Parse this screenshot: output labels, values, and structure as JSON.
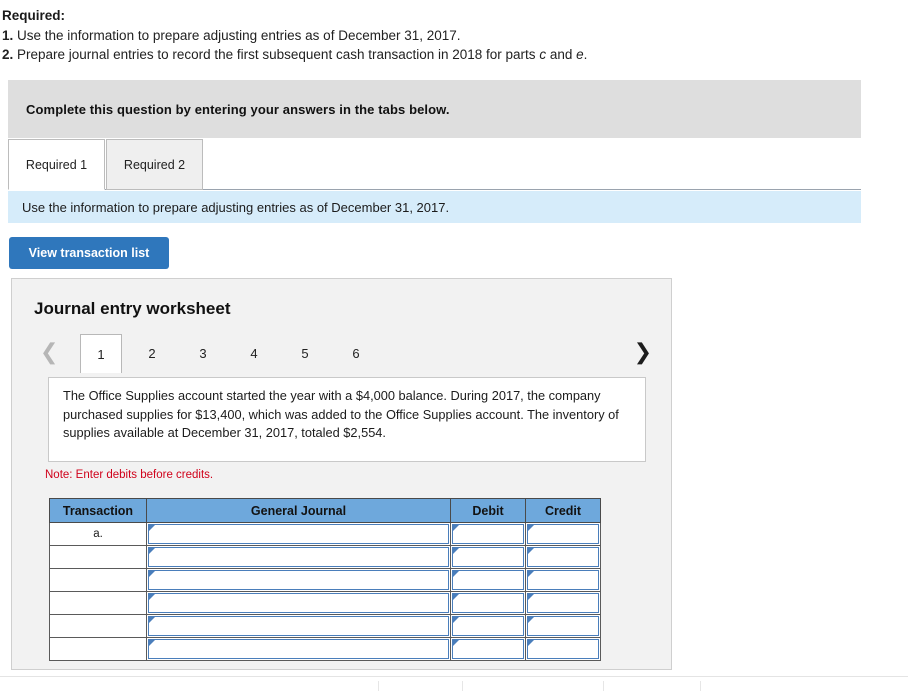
{
  "required": {
    "heading": "Required:",
    "items": [
      {
        "num": "1.",
        "text_before": " Use the information to prepare adjusting entries as of December 31, 2017.",
        "italic_a": "",
        "text_mid": "",
        "italic_b": "",
        "text_after": ""
      },
      {
        "num": "2.",
        "text_before": " Prepare journal entries to record the first subsequent cash transaction in 2018 for parts ",
        "italic_a": "c",
        "text_mid": " and ",
        "italic_b": "e",
        "text_after": "."
      }
    ]
  },
  "instruction_banner": {
    "text": "Complete this question by entering your answers in the tabs below.",
    "background": "#dedede"
  },
  "tabs": [
    {
      "label": "Required 1",
      "active": true
    },
    {
      "label": "Required 2",
      "active": false
    }
  ],
  "info_banner": {
    "text": "Use the information to prepare adjusting entries as of December 31, 2017.",
    "background": "#d6ecfa"
  },
  "toolbar": {
    "view_transaction_label": "View transaction list",
    "button_color": "#2f77bc"
  },
  "worksheet": {
    "title": "Journal entry worksheet",
    "prev_icon": "chevron-left-icon",
    "next_icon": "chevron-right-icon",
    "prev_enabled": false,
    "next_enabled": true,
    "pages": [
      {
        "label": "1",
        "active": true
      },
      {
        "label": "2",
        "active": false
      },
      {
        "label": "3",
        "active": false
      },
      {
        "label": "4",
        "active": false
      },
      {
        "label": "5",
        "active": false
      },
      {
        "label": "6",
        "active": false
      }
    ],
    "description": "The Office Supplies account started the year with a $4,000 balance. During 2017, the company purchased supplies for $13,400, which was added to the Office Supplies account. The inventory of supplies available at December 31, 2017, totaled $2,554.",
    "note": "Note: Enter debits before credits.",
    "note_color": "#d0021b",
    "table": {
      "header_color": "#6ea8dc",
      "columns": [
        "Transaction",
        "General Journal",
        "Debit",
        "Credit"
      ],
      "rows": [
        {
          "transaction": "a.",
          "general_journal": "",
          "debit": "",
          "credit": ""
        },
        {
          "transaction": "",
          "general_journal": "",
          "debit": "",
          "credit": ""
        },
        {
          "transaction": "",
          "general_journal": "",
          "debit": "",
          "credit": ""
        },
        {
          "transaction": "",
          "general_journal": "",
          "debit": "",
          "credit": ""
        },
        {
          "transaction": "",
          "general_journal": "",
          "debit": "",
          "credit": ""
        },
        {
          "transaction": "",
          "general_journal": "",
          "debit": "",
          "credit": ""
        }
      ]
    }
  }
}
